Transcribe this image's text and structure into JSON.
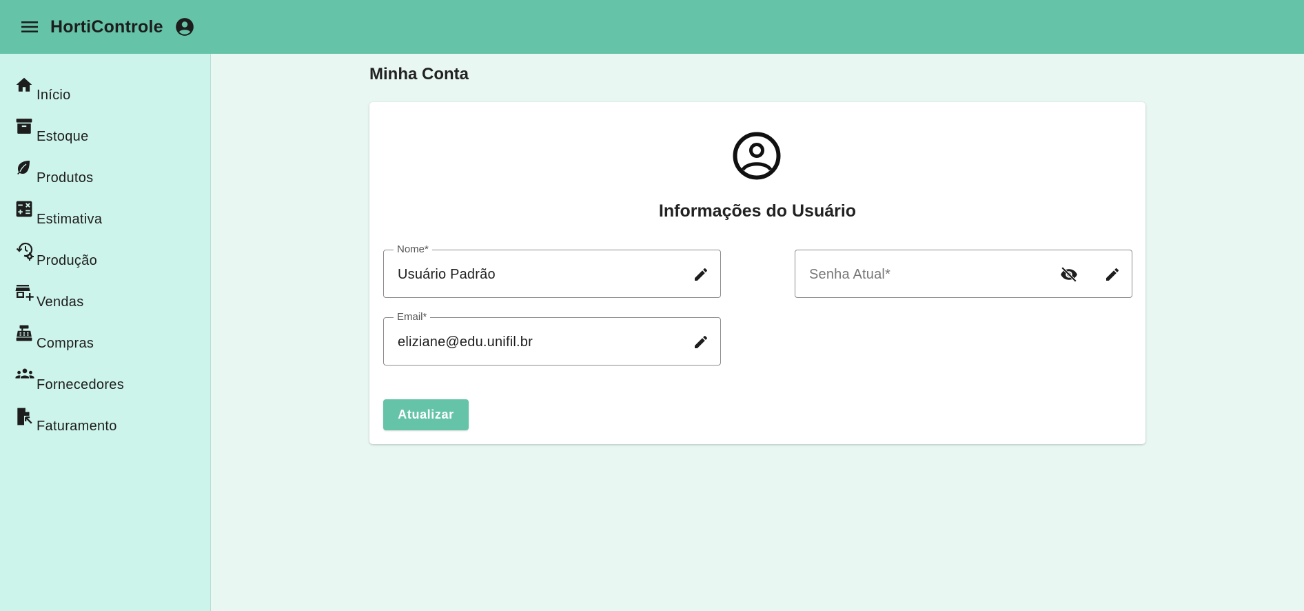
{
  "app": {
    "title": "HortiControle"
  },
  "header": {
    "menu_icon": "menu-icon",
    "account_icon": "account-circle-icon"
  },
  "sidebar": {
    "items": [
      {
        "label": "Início",
        "icon": "home-icon"
      },
      {
        "label": "Estoque",
        "icon": "archive-box-icon"
      },
      {
        "label": "Produtos",
        "icon": "leaf-icon"
      },
      {
        "label": "Estimativa",
        "icon": "calculator-icon"
      },
      {
        "label": "Produção",
        "icon": "history-gear-icon"
      },
      {
        "label": "Vendas",
        "icon": "store-add-icon"
      },
      {
        "label": "Compras",
        "icon": "cash-register-icon"
      },
      {
        "label": "Fornecedores",
        "icon": "people-group-icon"
      },
      {
        "label": "Faturamento",
        "icon": "file-export-icon"
      }
    ]
  },
  "main": {
    "page_title": "Minha Conta",
    "card": {
      "heading": "Informações do Usuário",
      "fields": {
        "nome": {
          "label": "Nome*",
          "value": "Usuário Padrão"
        },
        "email": {
          "label": "Email*",
          "value": "eliziane@edu.unifil.br"
        },
        "senha": {
          "placeholder": "Senha Atual*",
          "value": ""
        }
      },
      "submit_label": "Atualizar"
    }
  },
  "colors": {
    "accent": "#65c4a8",
    "sidebar_bg": "#cdf4ea",
    "page_bg": "#e8f7f2"
  }
}
